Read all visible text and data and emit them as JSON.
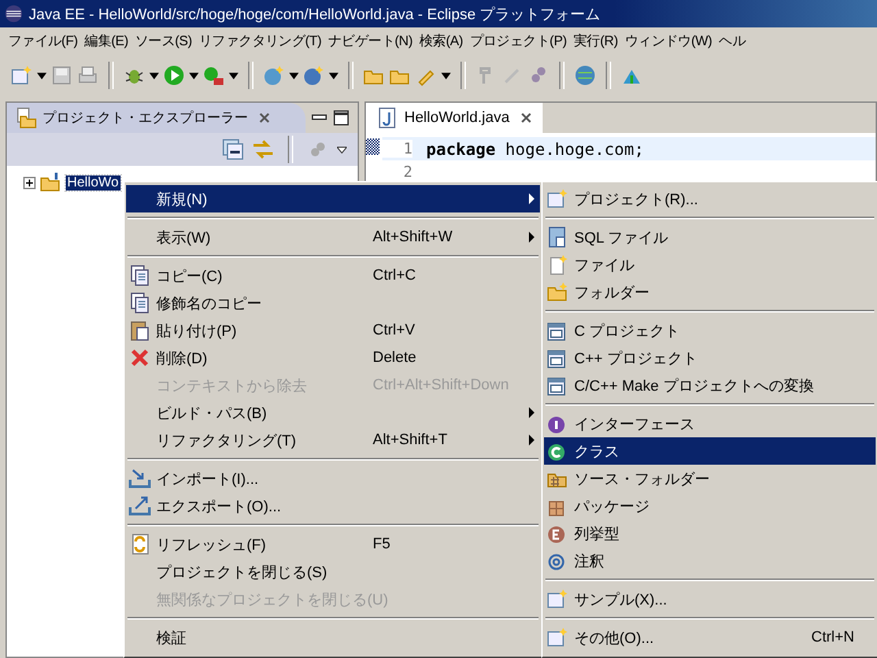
{
  "window": {
    "title": "Java EE - HelloWorld/src/hoge/hoge/com/HelloWorld.java - Eclipse プラットフォーム"
  },
  "menu_bar": [
    "ファイル(F)",
    "編集(E)",
    "ソース(S)",
    "リファクタリング(T)",
    "ナビゲート(N)",
    "検索(A)",
    "プロジェクト(P)",
    "実行(R)",
    "ウィンドウ(W)",
    "ヘル"
  ],
  "project_explorer": {
    "title": "プロジェクト・エクスプローラー",
    "tree": [
      {
        "label": "HelloWo",
        "selected": true,
        "expanded": false
      }
    ]
  },
  "editor": {
    "tab": "HelloWorld.java",
    "lines": [
      {
        "number": "1",
        "code": "**package** hoge.hoge.com;",
        "current": true
      },
      {
        "number": "2",
        "current": false
      }
    ]
  },
  "context_menu": {
    "items": [
      {
        "kind": "item",
        "label": "新規(N)",
        "submenu": true,
        "disabled": false,
        "selected": true
      },
      {
        "kind": "separator"
      },
      {
        "kind": "item",
        "label": "表示(W)",
        "shortcut": "Alt+Shift+W",
        "submenu": true,
        "disabled": false,
        "selected": false
      },
      {
        "kind": "separator"
      },
      {
        "kind": "item",
        "label": "コピー(C)",
        "shortcut": "Ctrl+C",
        "submenu": false,
        "disabled": false,
        "selected": false
      },
      {
        "kind": "item",
        "label": "修飾名のコピー",
        "submenu": false,
        "disabled": false,
        "selected": false
      },
      {
        "kind": "item",
        "label": "貼り付け(P)",
        "shortcut": "Ctrl+V",
        "submenu": false,
        "disabled": false,
        "selected": false
      },
      {
        "kind": "item",
        "label": "削除(D)",
        "shortcut": "Delete",
        "submenu": false,
        "disabled": false,
        "selected": false
      },
      {
        "kind": "item",
        "label": "コンテキストから除去",
        "shortcut": "Ctrl+Alt+Shift+Down",
        "submenu": false,
        "disabled": true,
        "selected": false
      },
      {
        "kind": "item",
        "label": "ビルド・パス(B)",
        "submenu": true,
        "disabled": false,
        "selected": false
      },
      {
        "kind": "item",
        "label": "リファクタリング(T)",
        "shortcut": "Alt+Shift+T",
        "submenu": true,
        "disabled": false,
        "selected": false
      },
      {
        "kind": "separator"
      },
      {
        "kind": "item",
        "label": "インポート(I)...",
        "submenu": false,
        "disabled": false,
        "selected": false
      },
      {
        "kind": "item",
        "label": "エクスポート(O)...",
        "submenu": false,
        "disabled": false,
        "selected": false
      },
      {
        "kind": "separator"
      },
      {
        "kind": "item",
        "label": "リフレッシュ(F)",
        "shortcut": "F5",
        "submenu": false,
        "disabled": false,
        "selected": false
      },
      {
        "kind": "item",
        "label": "プロジェクトを閉じる(S)",
        "submenu": false,
        "disabled": false,
        "selected": false
      },
      {
        "kind": "item",
        "label": "無関係なプロジェクトを閉じる(U)",
        "submenu": false,
        "disabled": true,
        "selected": false
      },
      {
        "kind": "separator"
      },
      {
        "kind": "item",
        "label": "検証",
        "submenu": false,
        "disabled": false,
        "selected": false
      }
    ]
  },
  "new_submenu": {
    "items": [
      {
        "kind": "item",
        "label": "プロジェクト(R)...",
        "selected": false
      },
      {
        "kind": "separator"
      },
      {
        "kind": "item",
        "label": "SQL ファイル",
        "selected": false
      },
      {
        "kind": "item",
        "label": "ファイル",
        "selected": false
      },
      {
        "kind": "item",
        "label": "フォルダー",
        "selected": false
      },
      {
        "kind": "separator"
      },
      {
        "kind": "item",
        "label": "C プロジェクト",
        "selected": false
      },
      {
        "kind": "item",
        "label": "C++ プロジェクト",
        "selected": false
      },
      {
        "kind": "item",
        "label": "C/C++ Make プロジェクトへの変換",
        "selected": false
      },
      {
        "kind": "separator"
      },
      {
        "kind": "item",
        "label": "インターフェース",
        "selected": false
      },
      {
        "kind": "item",
        "label": "クラス",
        "selected": true
      },
      {
        "kind": "item",
        "label": "ソース・フォルダー",
        "selected": false
      },
      {
        "kind": "item",
        "label": "パッケージ",
        "selected": false
      },
      {
        "kind": "item",
        "label": "列挙型",
        "selected": false
      },
      {
        "kind": "item",
        "label": "注釈",
        "selected": false
      },
      {
        "kind": "separator"
      },
      {
        "kind": "item",
        "label": "サンプル(X)...",
        "selected": false
      },
      {
        "kind": "separator"
      },
      {
        "kind": "item",
        "label": "その他(O)...",
        "shortcut": "Ctrl+N",
        "selected": false
      }
    ]
  }
}
